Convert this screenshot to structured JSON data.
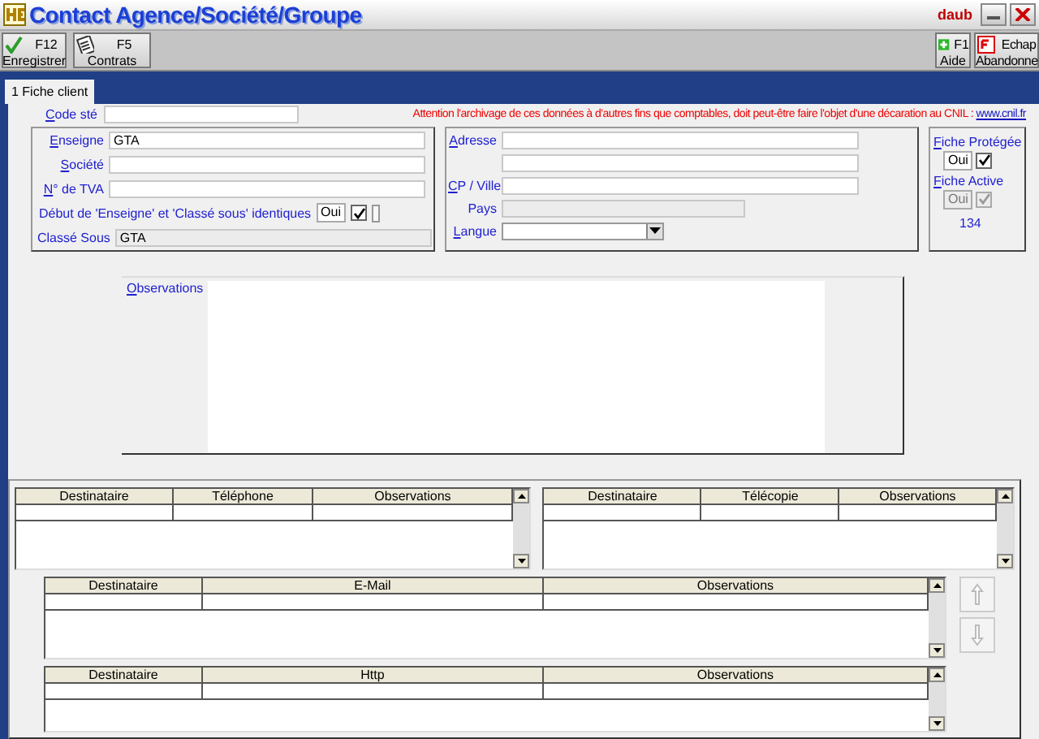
{
  "window": {
    "title": "Contact Agence/Société/Groupe",
    "user": "daub"
  },
  "toolbar": {
    "left": [
      {
        "key": "F12",
        "label": "Enregistrer",
        "kind": "save"
      },
      {
        "key": "F5",
        "label": "Contrats",
        "kind": "contracts"
      }
    ],
    "right": [
      {
        "key": "F1",
        "label": "Aide",
        "kind": "help"
      },
      {
        "key": "Echap",
        "label": "Abandonne",
        "kind": "cancel"
      }
    ]
  },
  "tabs": [
    {
      "label": "1 Fiche client",
      "selected": true
    }
  ],
  "code_ste": {
    "label": "Code sté"
  },
  "notice": {
    "text": "Attention l'archivage de ces données à d'autres fins que comptables, doit peut-être faire l'objet d'une décaration au CNIL :",
    "link": "www.cnil.fr"
  },
  "identity": {
    "fields": [
      {
        "label": "Enseigne",
        "value": "GTA",
        "disabled": false
      },
      {
        "label": "Société",
        "disabled": false
      },
      {
        "label": "N° de TVA",
        "disabled": false
      }
    ],
    "same_start": {
      "label": "Début de 'Enseigne' et 'Classé sous' identiques",
      "value": "Oui",
      "checked": true
    },
    "classed_under": {
      "label": "Classé Sous",
      "value": "GTA",
      "disabled": true
    }
  },
  "address": {
    "fields": [
      {
        "label": "Adresse",
        "kind": "text",
        "disabled": false
      },
      {
        "kind": "text",
        "disabled": false
      },
      {
        "label": "CP / Ville",
        "kind": "text",
        "disabled": false
      },
      {
        "label": "Pays",
        "kind": "text",
        "disabled": true
      },
      {
        "label": "Langue",
        "kind": "dropdown",
        "disabled": false
      }
    ]
  },
  "flags": [
    {
      "label": "Fiche Protégée",
      "value": "Oui",
      "checked": true,
      "disabled": false
    },
    {
      "label": "Fiche Active",
      "value": "Oui",
      "checked": true,
      "disabled": true
    }
  ],
  "record_number": "134",
  "observations": {
    "label": "Observations"
  },
  "tables": [
    {
      "columns": [
        "Destinataire",
        "Téléphone",
        "Observations"
      ]
    },
    {
      "columns": [
        "Destinataire",
        "Télécopie",
        "Observations"
      ]
    },
    {
      "columns": [
        "Destinataire",
        "E-Mail",
        "Observations"
      ]
    },
    {
      "columns": [
        "Destinataire",
        "Http",
        "Observations"
      ]
    }
  ]
}
